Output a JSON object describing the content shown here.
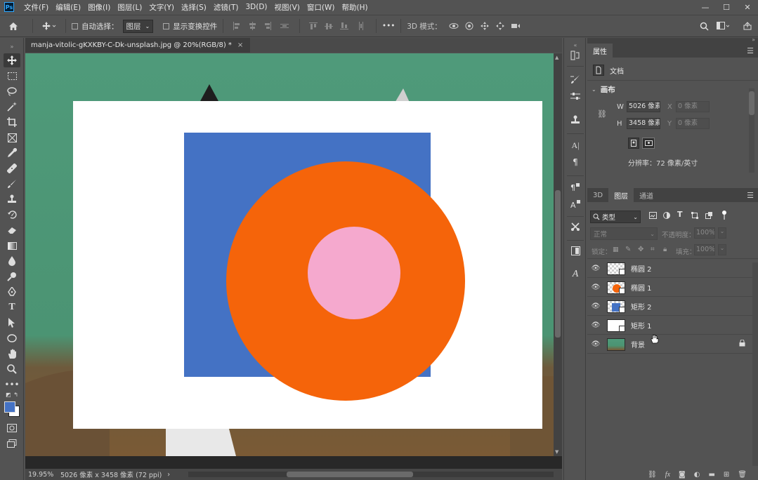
{
  "app": {
    "logo": "Ps"
  },
  "menu": [
    "文件(F)",
    "编辑(E)",
    "图像(I)",
    "图层(L)",
    "文字(Y)",
    "选择(S)",
    "滤镜(T)",
    "3D(D)",
    "视图(V)",
    "窗口(W)",
    "帮助(H)"
  ],
  "window_controls": {
    "minimize": "—",
    "maximize": "☐",
    "close": "✕"
  },
  "options": {
    "home_icon": "home-icon",
    "auto_select_label": "自动选择：",
    "auto_select_value": "图层",
    "show_transform_label": "显示变换控件",
    "more": "•••",
    "mode_3d_label": "3D 模式："
  },
  "document": {
    "tab_title": "manja-vitolic-gKXKBY-C-Dk-unsplash.jpg @ 20%(RGB/8) *",
    "close": "×",
    "colors": {
      "canvas": "#ffffff",
      "rect": "#4472c4",
      "ellipse_outer": "#f5640a",
      "ellipse_inner": "#f5a9ce"
    }
  },
  "status": {
    "zoom": "19.95%",
    "info": "5026 像素 x 3458 像素 (72 ppi)",
    "arrow": "›"
  },
  "properties": {
    "tab": "属性",
    "doc_label": "文档",
    "section": "画布",
    "w_label": "W",
    "w_value": "5026 像素",
    "h_label": "H",
    "h_value": "3458 像素",
    "x_label": "X",
    "x_placeholder": "0 像素",
    "y_label": "Y",
    "y_placeholder": "0 像素",
    "resolution": "分辨率：72 像素/英寸"
  },
  "layers_panel": {
    "tabs": [
      "3D",
      "图层",
      "通道"
    ],
    "filter_label": "类型",
    "blend_mode": "正常",
    "opacity_label": "不透明度：",
    "opacity_value": "100%",
    "lock_label": "锁定：",
    "fill_label": "填充：",
    "fill_value": "100%",
    "layers": [
      {
        "name": "椭圆 2"
      },
      {
        "name": "椭圆 1"
      },
      {
        "name": "矩形 2"
      },
      {
        "name": "矩形 1"
      },
      {
        "name": "背景"
      }
    ]
  }
}
